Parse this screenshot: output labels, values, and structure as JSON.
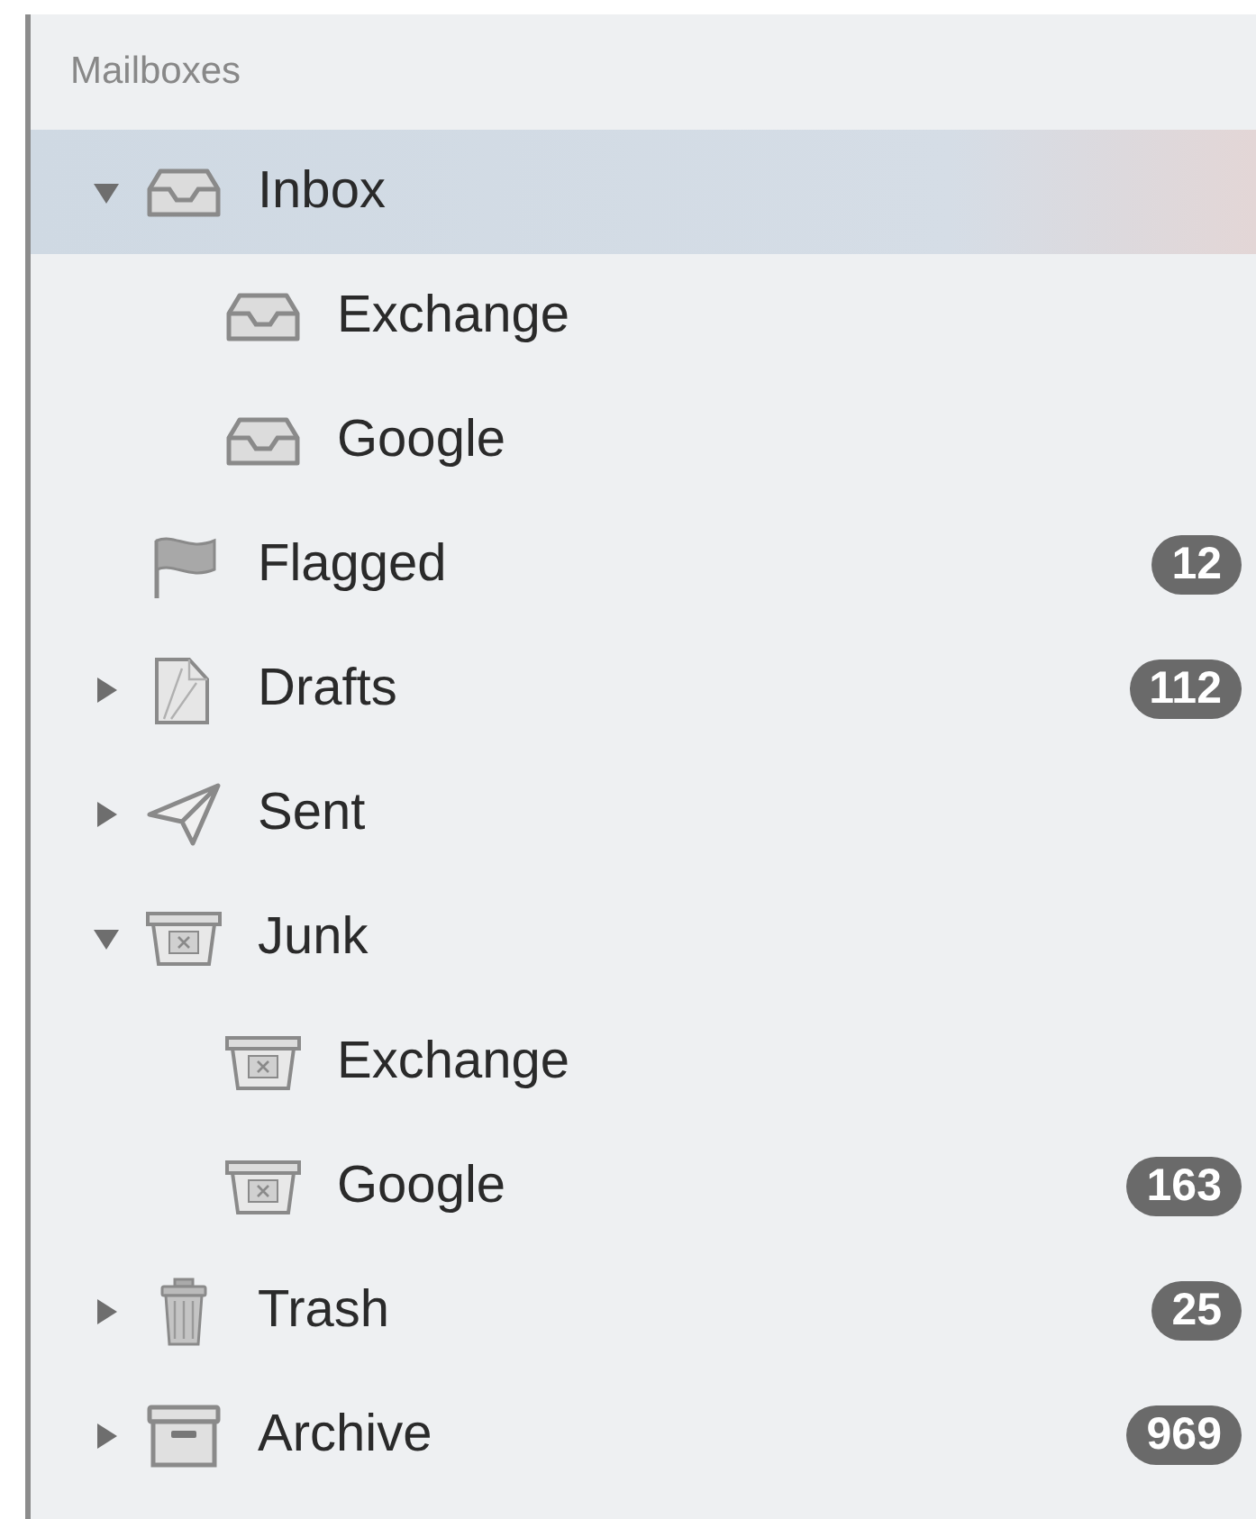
{
  "sidebar": {
    "header": "Mailboxes",
    "items": [
      {
        "label": "Inbox",
        "kind": "inbox",
        "selected": true,
        "expanded": true,
        "children": [
          {
            "label": "Exchange",
            "kind": "inbox",
            "selected": false
          },
          {
            "label": "Google",
            "kind": "inbox",
            "selected": false
          }
        ]
      },
      {
        "label": "Flagged",
        "kind": "flag",
        "selected": false,
        "badge": "12"
      },
      {
        "label": "Drafts",
        "kind": "drafts",
        "selected": false,
        "expanded": false,
        "badge": "112"
      },
      {
        "label": "Sent",
        "kind": "sent",
        "selected": false,
        "expanded": false
      },
      {
        "label": "Junk",
        "kind": "junk",
        "selected": false,
        "expanded": true,
        "children": [
          {
            "label": "Exchange",
            "kind": "junk",
            "selected": false
          },
          {
            "label": "Google",
            "kind": "junk",
            "selected": false,
            "badge": "163"
          }
        ]
      },
      {
        "label": "Trash",
        "kind": "trash",
        "selected": false,
        "expanded": false,
        "badge": "25"
      },
      {
        "label": "Archive",
        "kind": "archive",
        "selected": false,
        "expanded": false,
        "badge": "969"
      }
    ]
  }
}
